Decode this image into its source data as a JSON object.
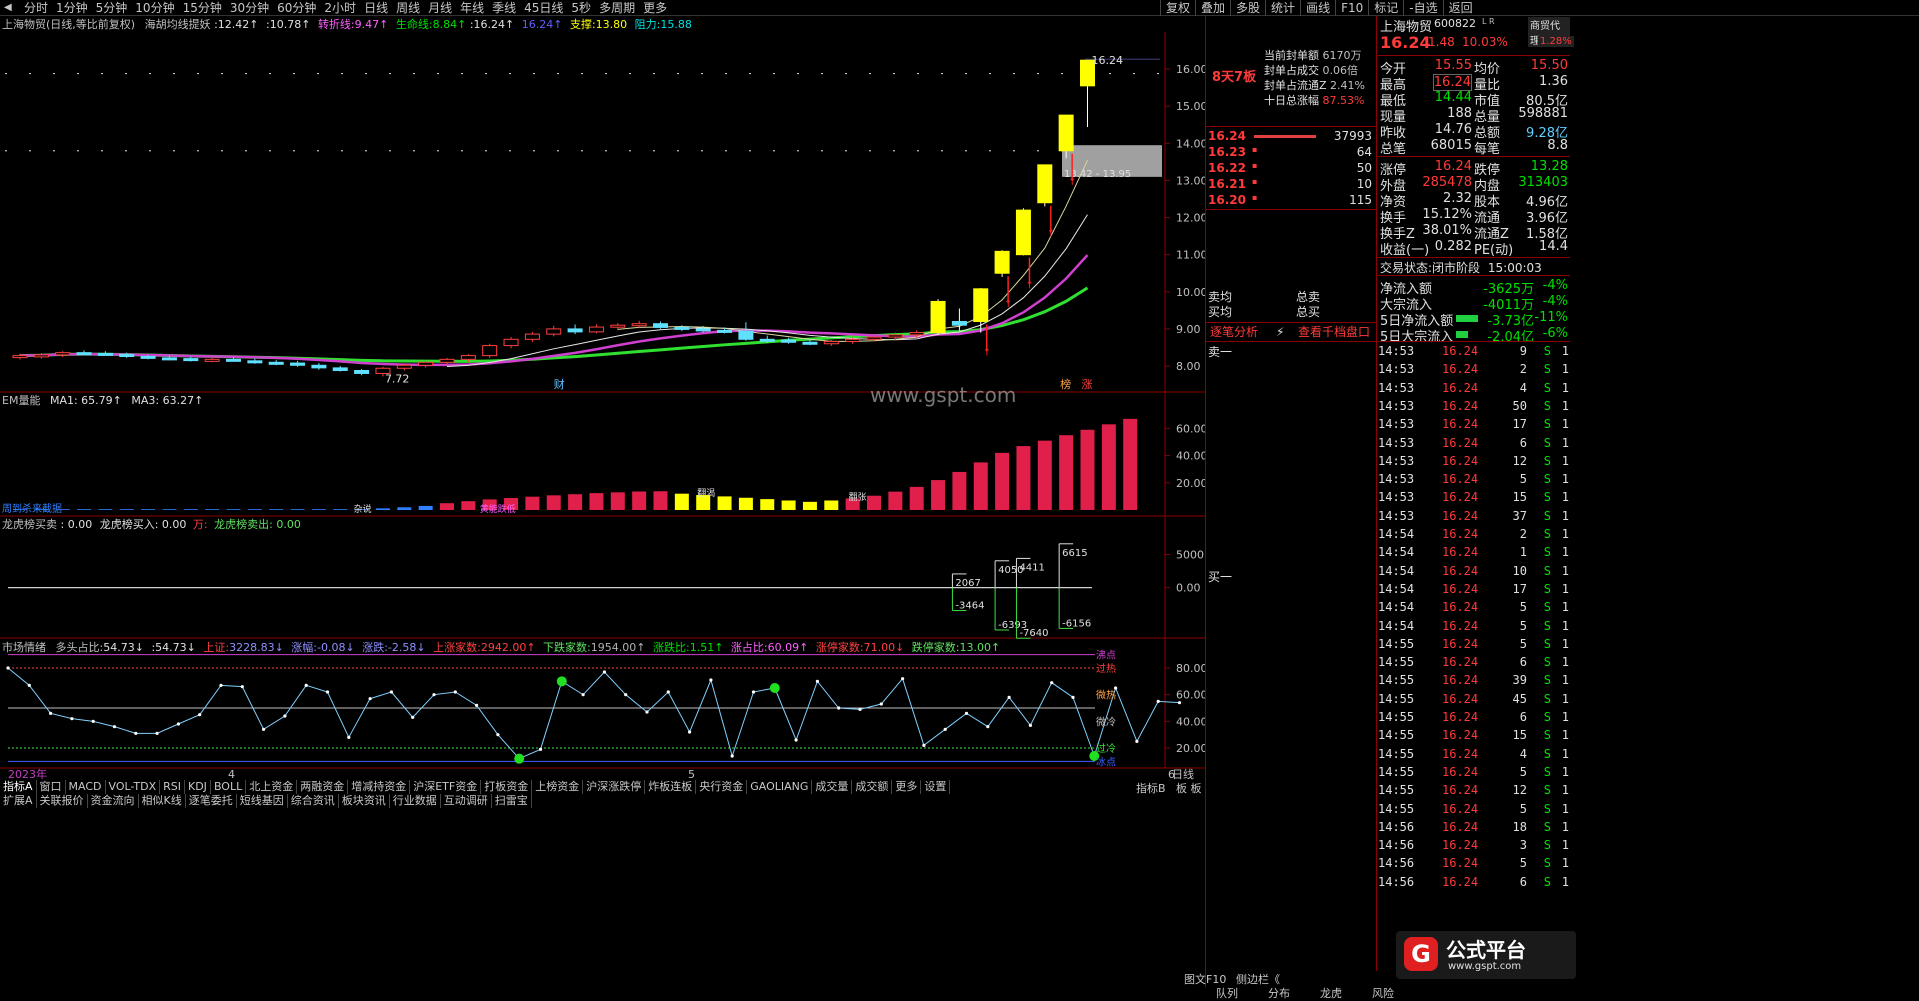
{
  "top_tabs": [
    "分时",
    "1分钟",
    "5分钟",
    "10分钟",
    "15分钟",
    "30分钟",
    "60分钟",
    "2小时",
    "日线",
    "周线",
    "月线",
    "年线",
    "季线",
    "45日线",
    "5秒",
    "多周期",
    "更多"
  ],
  "top_right": [
    "复权",
    "叠加",
    "多股",
    "统计",
    "画线",
    "F10",
    "标记",
    "-自选",
    "返回"
  ],
  "price_panel": {
    "title": "上海物贸(日线,等比前复权)",
    "ind_name": "海胡均线提妖",
    "v1": ":12.42↑",
    "v2": ":10.78↑",
    "zhuanzhe_label": "转折线:",
    "zhuanzhe_val": "9.47↑",
    "shengming_label": "生命线:",
    "shengming_val": "8.84↑",
    "v3": ":16.24↑",
    "v4": "16.24↑",
    "support": "支撑:13.80",
    "resistance": "阻力:15.88",
    "high_label": "16.24",
    "low_label": "7.72",
    "range_label": "13.42 - 13.95",
    "marker_cai": "财",
    "marker_bang": "榜",
    "marker_zhang": "涨",
    "watermark": "www.gspt.com"
  },
  "vol_panel": {
    "title": "EM量能",
    "ma1": "MA1: 65.79↑",
    "ma3": "MA3: 63.27↑",
    "text1": "周到杀来截据",
    "text2": "杂说",
    "text3": "黄能跌低",
    "text4": "翻渴",
    "text5": "翻张"
  },
  "lhb_panel": {
    "title": "龙虎榜买卖",
    "buy_label": "龙虎榜买入",
    "sell_label": "龙虎榜卖出",
    "v1": "0.00",
    "v2": "0.00",
    "v3": "0.00",
    "unit": "万:"
  },
  "sent_panel": {
    "title": "市场情绪",
    "multi_label": "多头占比:",
    "multi_val": "54.73↓",
    "v2": ":54.73↓",
    "sh_label": "上证:",
    "sh_val": "3228.83↓",
    "zf_label": "涨幅:",
    "zf_val": "-0.08↓",
    "zd_label": "涨跌:",
    "zd_val": "-2.58↓",
    "up_label": "上涨家数:",
    "up_val": "2942.00↑",
    "down_label": "下跌家数:",
    "down_val": "1954.00↑",
    "ratio_label": "涨跌比:",
    "ratio_val": "1.51↑",
    "zzb_label": "涨占比:",
    "zzb_val": "60.09↑",
    "zt_label": "涨停家数:",
    "zt_val": "71.00↓",
    "dt_label": "跌停家数:",
    "dt_val": "13.00↑",
    "lvl_hot": "过热",
    "lvl_warm": "微热",
    "lvl_cool": "微冷",
    "lvl_cold": "过冷",
    "lvl_ice": "冰点",
    "lvl_top": "沸点"
  },
  "axis_labels": {
    "year": "2023年",
    "m4": "4",
    "m5": "5",
    "m6": "6",
    "period": "日线"
  },
  "bottom_tabs1": [
    "指标A",
    "窗口",
    "MACD",
    "VOL-TDX",
    "RSI",
    "KDJ",
    "BOLL",
    "北上资金",
    "两融资金",
    "增减持资金",
    "沪深ETF资金",
    "打板资金",
    "上榜资金",
    "沪深涨跌停",
    "炸板连板",
    "央行资金",
    "GAOLIANG",
    "成交量",
    "成交额",
    "更多",
    "设置"
  ],
  "bottom_tabs2": [
    "扩展A",
    "关联报价",
    "资金流向",
    "相似K线",
    "逐笔委托",
    "短线基因",
    "综合资讯",
    "板块资讯",
    "行业数据",
    "互动调研",
    "扫雷宝"
  ],
  "board_info": {
    "days": "8天7板",
    "fd_label": "当前封单额",
    "fd_val": "6170万",
    "cj_label": "封单占成交",
    "cj_val": "0.06倍",
    "lt_label": "封单占流通Z",
    "lt_val": "2.41%",
    "zf_label": "十日总涨幅",
    "zf_val": "87.53%"
  },
  "orderbook": {
    "rows": [
      {
        "p": "16.24",
        "v": "37993"
      },
      {
        "p": "16.23",
        "v": "64"
      },
      {
        "p": "16.22",
        "v": "50"
      },
      {
        "p": "16.21",
        "v": "10"
      },
      {
        "p": "16.20",
        "v": "115"
      }
    ],
    "sell_avg": "卖均",
    "sell_total": "总卖",
    "buy_avg": "买均",
    "buy_total": "总买",
    "tick_analysis": "逐笔分析",
    "view_1000": "查看千档盘口",
    "sell1": "卖一",
    "buy1": "买一"
  },
  "quote": {
    "name": "上海物贸",
    "code": "600822",
    "flag": "L R",
    "sector": "商贸代理",
    "sector_pct": "1.28%",
    "price": "16.24",
    "chg": "1.48",
    "pct": "10.03%",
    "rows": [
      [
        "今开",
        "15.55",
        "均价",
        "15.50"
      ],
      [
        "最高",
        "16.24",
        "量比",
        "1.36"
      ],
      [
        "最低",
        "14.44",
        "市值",
        "80.5亿"
      ],
      [
        "现量",
        "188",
        "总量",
        "598881"
      ],
      [
        "昨收",
        "14.76",
        "总额",
        "9.28亿"
      ],
      [
        "总笔",
        "68015",
        "每笔",
        "8.8"
      ]
    ],
    "rows2": [
      [
        "涨停",
        "16.24",
        "跌停",
        "13.28"
      ],
      [
        "外盘",
        "285478",
        "内盘",
        "313403"
      ],
      [
        "净资",
        "2.32",
        "股本",
        "4.96亿"
      ],
      [
        "换手",
        "15.12%",
        "流通",
        "3.96亿"
      ],
      [
        "换手Z",
        "38.01%",
        "流通Z",
        "1.58亿"
      ],
      [
        "收益(一)",
        "0.282",
        "PE(动)",
        "14.4"
      ]
    ],
    "status_label": "交易状态:",
    "status": "闭市阶段",
    "time": "15:00:03",
    "flows": [
      {
        "label": "净流入额",
        "val": "-3625万",
        "pct": "-4%"
      },
      {
        "label": "大宗流入",
        "val": "-4011万",
        "pct": "-4%"
      },
      {
        "label": "5日净流入额",
        "val": "-3.73亿",
        "pct": "-11%"
      },
      {
        "label": "5日大宗流入",
        "val": "-2.04亿",
        "pct": "-6%"
      }
    ]
  },
  "ticks": [
    [
      "14:53",
      "16.24",
      "9",
      "S"
    ],
    [
      "14:53",
      "16.24",
      "2",
      "S"
    ],
    [
      "14:53",
      "16.24",
      "4",
      "S"
    ],
    [
      "14:53",
      "16.24",
      "50",
      "S"
    ],
    [
      "14:53",
      "16.24",
      "17",
      "S"
    ],
    [
      "14:53",
      "16.24",
      "6",
      "S"
    ],
    [
      "14:53",
      "16.24",
      "12",
      "S"
    ],
    [
      "14:53",
      "16.24",
      "5",
      "S"
    ],
    [
      "14:53",
      "16.24",
      "15",
      "S"
    ],
    [
      "14:53",
      "16.24",
      "37",
      "S"
    ],
    [
      "14:54",
      "16.24",
      "2",
      "S"
    ],
    [
      "14:54",
      "16.24",
      "1",
      "S"
    ],
    [
      "14:54",
      "16.24",
      "10",
      "S"
    ],
    [
      "14:54",
      "16.24",
      "17",
      "S"
    ],
    [
      "14:54",
      "16.24",
      "5",
      "S"
    ],
    [
      "14:54",
      "16.24",
      "5",
      "S"
    ],
    [
      "14:55",
      "16.24",
      "5",
      "S"
    ],
    [
      "14:55",
      "16.24",
      "6",
      "S"
    ],
    [
      "14:55",
      "16.24",
      "39",
      "S"
    ],
    [
      "14:55",
      "16.24",
      "45",
      "S"
    ],
    [
      "14:55",
      "16.24",
      "6",
      "S"
    ],
    [
      "14:55",
      "16.24",
      "15",
      "S"
    ],
    [
      "14:55",
      "16.24",
      "4",
      "S"
    ],
    [
      "14:55",
      "16.24",
      "5",
      "S"
    ],
    [
      "14:55",
      "16.24",
      "12",
      "S"
    ],
    [
      "14:55",
      "16.24",
      "5",
      "S"
    ],
    [
      "14:56",
      "16.24",
      "18",
      "S"
    ],
    [
      "14:56",
      "16.24",
      "3",
      "S"
    ],
    [
      "14:56",
      "16.24",
      "5",
      "S"
    ],
    [
      "14:56",
      "16.24",
      "6",
      "S"
    ]
  ],
  "bottom_right": [
    "图文F10",
    "侧边栏《",
    "队列",
    "分布",
    "龙虎",
    "风险"
  ],
  "bottom_right_mid": [
    "指标B",
    "板 板"
  ],
  "logo_text": "公式平台",
  "logo_url": "www.gspt.com",
  "chart_data": [
    {
      "type": "candlestick",
      "title": "上海物贸(日线,等比前复权)",
      "ylim": [
        7.3,
        17.0
      ],
      "y_ticks": [
        8,
        9,
        10,
        11,
        12,
        13,
        14,
        15,
        16
      ],
      "candles": [
        {
          "o": 8.25,
          "h": 8.33,
          "l": 8.18,
          "c": 8.28
        },
        {
          "o": 8.28,
          "h": 8.35,
          "l": 8.2,
          "c": 8.3
        },
        {
          "o": 8.3,
          "h": 8.4,
          "l": 8.24,
          "c": 8.36
        },
        {
          "o": 8.36,
          "h": 8.42,
          "l": 8.3,
          "c": 8.34
        },
        {
          "o": 8.34,
          "h": 8.4,
          "l": 8.28,
          "c": 8.31
        },
        {
          "o": 8.31,
          "h": 8.36,
          "l": 8.22,
          "c": 8.26
        },
        {
          "o": 8.26,
          "h": 8.3,
          "l": 8.18,
          "c": 8.22
        },
        {
          "o": 8.22,
          "h": 8.28,
          "l": 8.15,
          "c": 8.2
        },
        {
          "o": 8.2,
          "h": 8.26,
          "l": 8.12,
          "c": 8.16
        },
        {
          "o": 8.16,
          "h": 8.22,
          "l": 8.1,
          "c": 8.18
        },
        {
          "o": 8.18,
          "h": 8.24,
          "l": 8.12,
          "c": 8.14
        },
        {
          "o": 8.14,
          "h": 8.2,
          "l": 8.06,
          "c": 8.1
        },
        {
          "o": 8.1,
          "h": 8.16,
          "l": 8.02,
          "c": 8.08
        },
        {
          "o": 8.08,
          "h": 8.14,
          "l": 7.98,
          "c": 8.02
        },
        {
          "o": 8.02,
          "h": 8.08,
          "l": 7.9,
          "c": 7.95
        },
        {
          "o": 7.95,
          "h": 8.0,
          "l": 7.85,
          "c": 7.88
        },
        {
          "o": 7.88,
          "h": 7.92,
          "l": 7.75,
          "c": 7.8
        },
        {
          "o": 7.8,
          "h": 7.98,
          "l": 7.72,
          "c": 7.94
        },
        {
          "o": 7.94,
          "h": 8.06,
          "l": 7.88,
          "c": 8.02
        },
        {
          "o": 8.02,
          "h": 8.14,
          "l": 7.96,
          "c": 8.1
        },
        {
          "o": 8.1,
          "h": 8.22,
          "l": 8.04,
          "c": 8.18
        },
        {
          "o": 8.18,
          "h": 8.32,
          "l": 8.1,
          "c": 8.28
        },
        {
          "o": 8.28,
          "h": 8.6,
          "l": 8.22,
          "c": 8.55
        },
        {
          "o": 8.55,
          "h": 8.78,
          "l": 8.48,
          "c": 8.72
        },
        {
          "o": 8.72,
          "h": 8.92,
          "l": 8.65,
          "c": 8.86
        },
        {
          "o": 8.86,
          "h": 9.08,
          "l": 8.8,
          "c": 9.0
        },
        {
          "o": 9.0,
          "h": 9.12,
          "l": 8.86,
          "c": 8.92
        },
        {
          "o": 8.92,
          "h": 9.12,
          "l": 8.88,
          "c": 9.05
        },
        {
          "o": 9.05,
          "h": 9.16,
          "l": 8.96,
          "c": 9.1
        },
        {
          "o": 9.1,
          "h": 9.22,
          "l": 9.02,
          "c": 9.14
        },
        {
          "o": 9.14,
          "h": 9.2,
          "l": 9.0,
          "c": 9.04
        },
        {
          "o": 9.04,
          "h": 9.1,
          "l": 8.94,
          "c": 9.0
        },
        {
          "o": 9.0,
          "h": 9.08,
          "l": 8.9,
          "c": 8.96
        },
        {
          "o": 8.96,
          "h": 9.04,
          "l": 8.88,
          "c": 8.94
        },
        {
          "o": 8.94,
          "h": 9.18,
          "l": 8.68,
          "c": 8.72
        },
        {
          "o": 8.72,
          "h": 8.82,
          "l": 8.62,
          "c": 8.7
        },
        {
          "o": 8.7,
          "h": 8.76,
          "l": 8.6,
          "c": 8.64
        },
        {
          "o": 8.64,
          "h": 8.72,
          "l": 8.56,
          "c": 8.6
        },
        {
          "o": 8.6,
          "h": 8.7,
          "l": 8.54,
          "c": 8.66
        },
        {
          "o": 8.66,
          "h": 8.76,
          "l": 8.6,
          "c": 8.72
        },
        {
          "o": 8.72,
          "h": 8.82,
          "l": 8.66,
          "c": 8.78
        },
        {
          "o": 8.78,
          "h": 8.9,
          "l": 8.7,
          "c": 8.84
        },
        {
          "o": 8.84,
          "h": 8.96,
          "l": 8.76,
          "c": 8.9
        },
        {
          "o": 8.9,
          "h": 9.8,
          "l": 8.84,
          "c": 9.74
        },
        {
          "o": 9.2,
          "h": 9.55,
          "l": 8.95,
          "c": 9.1
        },
        {
          "o": 9.2,
          "h": 10.1,
          "l": 8.9,
          "c": 10.08
        },
        {
          "o": 10.5,
          "h": 11.12,
          "l": 10.4,
          "c": 11.09
        },
        {
          "o": 11.0,
          "h": 12.25,
          "l": 10.98,
          "c": 12.2
        },
        {
          "o": 12.4,
          "h": 13.42,
          "l": 12.3,
          "c": 13.42
        },
        {
          "o": 13.8,
          "h": 14.76,
          "l": 13.6,
          "c": 14.76
        },
        {
          "o": 15.55,
          "h": 16.24,
          "l": 14.44,
          "c": 16.24
        }
      ]
    },
    {
      "type": "bar",
      "title": "EM量能",
      "ylim": [
        0,
        75
      ],
      "y_ticks": [
        20,
        40,
        60
      ],
      "values": [
        0.6,
        0.6,
        0.6,
        0.6,
        0.6,
        0.6,
        0.6,
        0.6,
        0.6,
        0.6,
        0.6,
        0.6,
        0.6,
        0.6,
        0.6,
        0.6,
        0.6,
        1.2,
        2.0,
        3.0,
        5.0,
        6.5,
        7.8,
        8.8,
        9.8,
        10.8,
        11.6,
        12.4,
        13.0,
        13.6,
        13.8,
        12.0,
        11.0,
        10.0,
        9.0,
        8.0,
        7.0,
        6.0,
        7.0,
        8.5,
        10.5,
        13.5,
        17.0,
        22.0,
        28.0,
        35.0,
        42.0,
        47.0,
        51.0,
        55.0,
        59.0,
        63.0,
        67.0
      ]
    },
    {
      "type": "bar",
      "title": "龙虎榜买卖",
      "ylim": [
        -7000,
        9000
      ],
      "y_ticks": [
        0,
        5000
      ],
      "series": [
        {
          "name": "龙虎榜买入",
          "x": [
            44,
            46,
            47,
            49
          ],
          "values": [
            2067,
            4050,
            4411,
            6615
          ]
        },
        {
          "name": "龙虎榜卖出",
          "x": [
            44,
            46,
            47,
            49
          ],
          "values": [
            -3464,
            -6393,
            -7640,
            -6156
          ]
        }
      ]
    },
    {
      "type": "line",
      "title": "市场情绪",
      "ylim": [
        5,
        95
      ],
      "y_ticks": [
        20,
        40,
        60,
        80
      ],
      "values": [
        80,
        67,
        46,
        42,
        40,
        36,
        31,
        31,
        38,
        45,
        67,
        66,
        34,
        44,
        67,
        62,
        28,
        57,
        62,
        43,
        60,
        62,
        52,
        30,
        12,
        19,
        70,
        60,
        77,
        60,
        47,
        62,
        32,
        71,
        14,
        62,
        65,
        26,
        70,
        50,
        49,
        53,
        72,
        22,
        34,
        46,
        36,
        58,
        37,
        69,
        58,
        14,
        65,
        25,
        55,
        54
      ],
      "markers": [
        24,
        26,
        36,
        51
      ]
    }
  ]
}
